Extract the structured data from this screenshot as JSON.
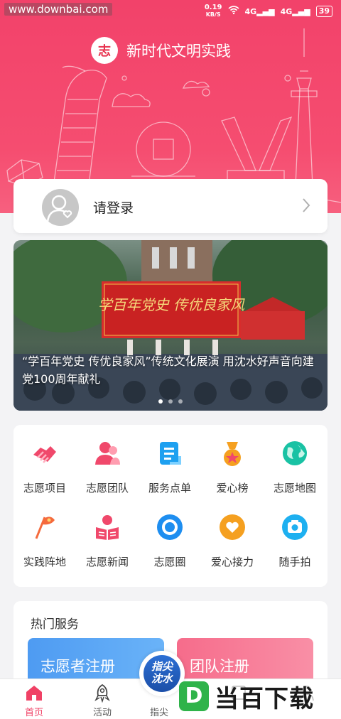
{
  "status_bar": {
    "watermark": "www.downbai.com",
    "net_speed_value": "0.19",
    "net_speed_unit": "KB/S",
    "signal1": "4G",
    "signal2": "4G",
    "battery": "39"
  },
  "header": {
    "logo_char": "志",
    "title": "新时代文明实践"
  },
  "login": {
    "text": "请登录"
  },
  "banner": {
    "caption": "“学百年党史 传优良家风”传统文化展演 用沈水好声音向建党100周年献礼",
    "stage_text": "学百年党史 传优良家风",
    "dots": 3,
    "active_dot": 0
  },
  "grid": {
    "items": [
      {
        "label": "志愿项目",
        "icon": "handshake-icon",
        "color": "#f0486b"
      },
      {
        "label": "志愿团队",
        "icon": "team-icon",
        "color": "#f0486b"
      },
      {
        "label": "服务点单",
        "icon": "order-icon",
        "color": "#1ea0f0"
      },
      {
        "label": "爱心榜",
        "icon": "medal-icon",
        "color": "#f5a020"
      },
      {
        "label": "志愿地图",
        "icon": "globe-icon",
        "color": "#19c2a4"
      },
      {
        "label": "实践阵地",
        "icon": "flag-icon",
        "color": "#f56a3c"
      },
      {
        "label": "志愿新闻",
        "icon": "reader-icon",
        "color": "#f0486b"
      },
      {
        "label": "志愿圈",
        "icon": "circle-icon",
        "color": "#1e8ef0"
      },
      {
        "label": "爱心接力",
        "icon": "heart-hands-icon",
        "color": "#f5a020"
      },
      {
        "label": "随手拍",
        "icon": "camera-icon",
        "color": "#1eb0f0"
      }
    ]
  },
  "hot_services": {
    "title": "热门服务",
    "volunteer_register": "志愿者注册",
    "team_register": "团队注册"
  },
  "float_button": {
    "line1": "指尖",
    "line2": "沈水"
  },
  "tabbar": {
    "tabs": [
      {
        "label": "首页",
        "icon": "home-icon"
      },
      {
        "label": "活动",
        "icon": "rocket-icon"
      },
      {
        "label": "指尖",
        "icon": "fingertip-icon"
      },
      {
        "label": "",
        "icon": "news-icon"
      },
      {
        "label": "",
        "icon": "profile-icon"
      }
    ],
    "active": 0
  },
  "brand_watermark": {
    "logo": "D",
    "text": "当百下载"
  }
}
